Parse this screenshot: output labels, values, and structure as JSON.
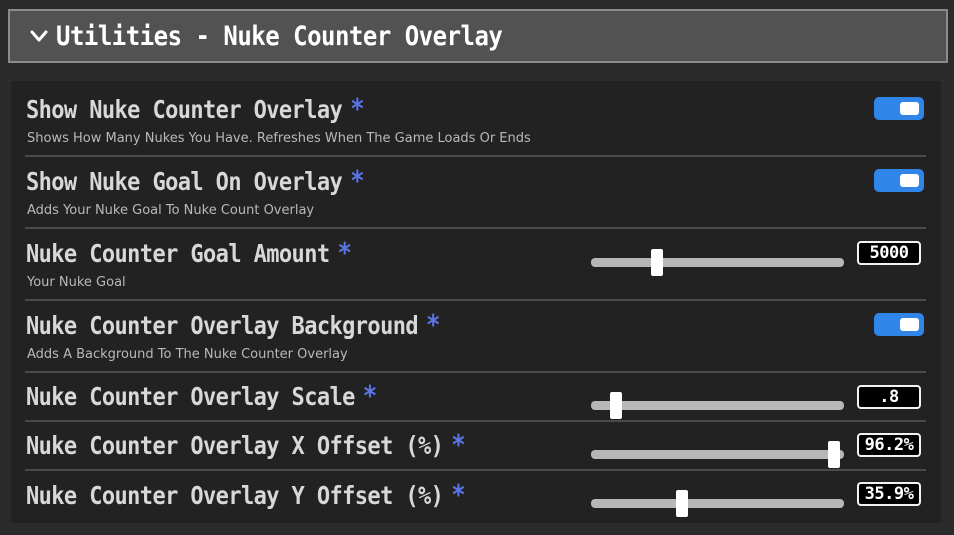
{
  "header": {
    "title": "Utilities - Nuke Counter Overlay",
    "icon": "chevron-down-icon"
  },
  "colors": {
    "toggle_on": "#2f86e8",
    "star": "#5b74e6",
    "panel": "#222222",
    "header": "#525252"
  },
  "settings": [
    {
      "title": "Show Nuke Counter Overlay",
      "star": "*",
      "description": "Shows How Many Nukes You Have. Refreshes When The Game Loads Or Ends",
      "type": "toggle",
      "enabled": true
    },
    {
      "title": "Show Nuke Goal On Overlay",
      "star": "*",
      "description": "Adds Your Nuke Goal To Nuke Count Overlay",
      "type": "toggle",
      "enabled": true
    },
    {
      "title": "Nuke Counter Goal Amount",
      "star": "*",
      "description": "Your Nuke Goal",
      "type": "slider",
      "value": "5000",
      "fraction": 0.26
    },
    {
      "title": "Nuke Counter Overlay Background",
      "star": "*",
      "description": "Adds A Background To The Nuke Counter Overlay",
      "type": "toggle",
      "enabled": true
    },
    {
      "title": "Nuke Counter Overlay Scale",
      "star": "*",
      "description": "",
      "type": "slider",
      "value": ".8",
      "fraction": 0.1
    },
    {
      "title": "Nuke Counter Overlay X Offset (%)",
      "star": "*",
      "description": "",
      "type": "slider",
      "value": "96.2%",
      "fraction": 0.962
    },
    {
      "title": "Nuke Counter Overlay Y Offset (%)",
      "star": "*",
      "description": "",
      "type": "slider",
      "value": "35.9%",
      "fraction": 0.359
    }
  ]
}
